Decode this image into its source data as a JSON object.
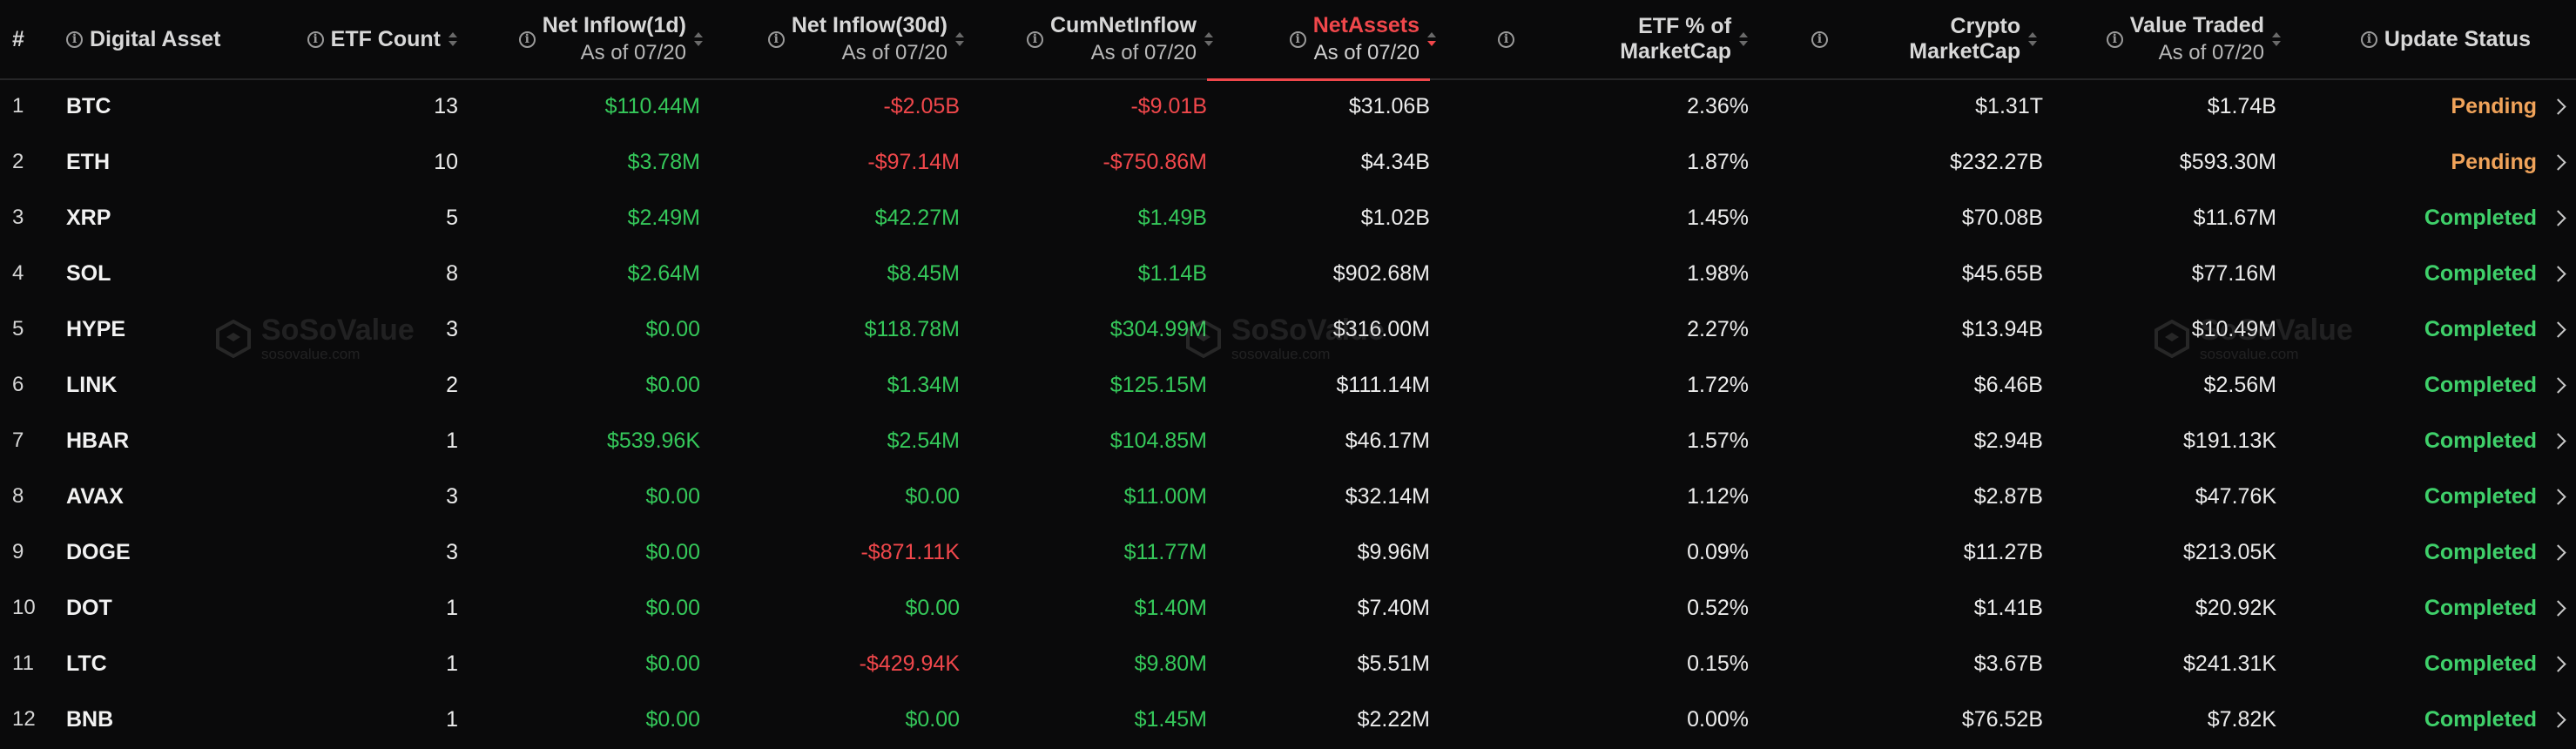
{
  "columns": {
    "index": "#",
    "asset": "Digital Asset",
    "etf_count": "ETF Count",
    "net_inflow_1d": {
      "label": "Net Inflow(1d)",
      "sub": "As of 07/20"
    },
    "net_inflow_30d": {
      "label": "Net Inflow(30d)",
      "sub": "As of 07/20"
    },
    "cum_net_inflow": {
      "label": "CumNetInflow",
      "sub": "As of 07/20"
    },
    "net_assets": {
      "label": "NetAssets",
      "sub": "As of 07/20"
    },
    "etf_pct_marketcap": "ETF % of MarketCap",
    "crypto_marketcap": "Crypto MarketCap",
    "value_traded": {
      "label": "Value Traded",
      "sub": "As of 07/20"
    },
    "update_status": "Update Status"
  },
  "colors": {
    "positive": "#35c85a",
    "negative": "#f0474b",
    "pending": "#f0a35a",
    "completed": "#3fd06a",
    "active_sort": "#f0474b"
  },
  "watermark": {
    "brand": "SoSoValue",
    "domain": "sosovalue.com"
  },
  "rows": [
    {
      "index": "1",
      "asset": "BTC",
      "etf_count": "13",
      "inflow_1d": "$110.44M",
      "inflow_1d_sign": "pos",
      "inflow_30d": "-$2.05B",
      "inflow_30d_sign": "neg",
      "cum": "-$9.01B",
      "cum_sign": "neg",
      "net_assets": "$31.06B",
      "etf_pct": "2.36%",
      "marketcap": "$1.31T",
      "traded": "$1.74B",
      "status": "Pending"
    },
    {
      "index": "2",
      "asset": "ETH",
      "etf_count": "10",
      "inflow_1d": "$3.78M",
      "inflow_1d_sign": "pos",
      "inflow_30d": "-$97.14M",
      "inflow_30d_sign": "neg",
      "cum": "-$750.86M",
      "cum_sign": "neg",
      "net_assets": "$4.34B",
      "etf_pct": "1.87%",
      "marketcap": "$232.27B",
      "traded": "$593.30M",
      "status": "Pending"
    },
    {
      "index": "3",
      "asset": "XRP",
      "etf_count": "5",
      "inflow_1d": "$2.49M",
      "inflow_1d_sign": "pos",
      "inflow_30d": "$42.27M",
      "inflow_30d_sign": "pos",
      "cum": "$1.49B",
      "cum_sign": "pos",
      "net_assets": "$1.02B",
      "etf_pct": "1.45%",
      "marketcap": "$70.08B",
      "traded": "$11.67M",
      "status": "Completed"
    },
    {
      "index": "4",
      "asset": "SOL",
      "etf_count": "8",
      "inflow_1d": "$2.64M",
      "inflow_1d_sign": "pos",
      "inflow_30d": "$8.45M",
      "inflow_30d_sign": "pos",
      "cum": "$1.14B",
      "cum_sign": "pos",
      "net_assets": "$902.68M",
      "etf_pct": "1.98%",
      "marketcap": "$45.65B",
      "traded": "$77.16M",
      "status": "Completed"
    },
    {
      "index": "5",
      "asset": "HYPE",
      "etf_count": "3",
      "inflow_1d": "$0.00",
      "inflow_1d_sign": "pos",
      "inflow_30d": "$118.78M",
      "inflow_30d_sign": "pos",
      "cum": "$304.99M",
      "cum_sign": "pos",
      "net_assets": "$316.00M",
      "etf_pct": "2.27%",
      "marketcap": "$13.94B",
      "traded": "$10.49M",
      "status": "Completed"
    },
    {
      "index": "6",
      "asset": "LINK",
      "etf_count": "2",
      "inflow_1d": "$0.00",
      "inflow_1d_sign": "pos",
      "inflow_30d": "$1.34M",
      "inflow_30d_sign": "pos",
      "cum": "$125.15M",
      "cum_sign": "pos",
      "net_assets": "$111.14M",
      "etf_pct": "1.72%",
      "marketcap": "$6.46B",
      "traded": "$2.56M",
      "status": "Completed"
    },
    {
      "index": "7",
      "asset": "HBAR",
      "etf_count": "1",
      "inflow_1d": "$539.96K",
      "inflow_1d_sign": "pos",
      "inflow_30d": "$2.54M",
      "inflow_30d_sign": "pos",
      "cum": "$104.85M",
      "cum_sign": "pos",
      "net_assets": "$46.17M",
      "etf_pct": "1.57%",
      "marketcap": "$2.94B",
      "traded": "$191.13K",
      "status": "Completed"
    },
    {
      "index": "8",
      "asset": "AVAX",
      "etf_count": "3",
      "inflow_1d": "$0.00",
      "inflow_1d_sign": "pos",
      "inflow_30d": "$0.00",
      "inflow_30d_sign": "pos",
      "cum": "$11.00M",
      "cum_sign": "pos",
      "net_assets": "$32.14M",
      "etf_pct": "1.12%",
      "marketcap": "$2.87B",
      "traded": "$47.76K",
      "status": "Completed"
    },
    {
      "index": "9",
      "asset": "DOGE",
      "etf_count": "3",
      "inflow_1d": "$0.00",
      "inflow_1d_sign": "pos",
      "inflow_30d": "-$871.11K",
      "inflow_30d_sign": "neg",
      "cum": "$11.77M",
      "cum_sign": "pos",
      "net_assets": "$9.96M",
      "etf_pct": "0.09%",
      "marketcap": "$11.27B",
      "traded": "$213.05K",
      "status": "Completed"
    },
    {
      "index": "10",
      "asset": "DOT",
      "etf_count": "1",
      "inflow_1d": "$0.00",
      "inflow_1d_sign": "pos",
      "inflow_30d": "$0.00",
      "inflow_30d_sign": "pos",
      "cum": "$1.40M",
      "cum_sign": "pos",
      "net_assets": "$7.40M",
      "etf_pct": "0.52%",
      "marketcap": "$1.41B",
      "traded": "$20.92K",
      "status": "Completed"
    },
    {
      "index": "11",
      "asset": "LTC",
      "etf_count": "1",
      "inflow_1d": "$0.00",
      "inflow_1d_sign": "pos",
      "inflow_30d": "-$429.94K",
      "inflow_30d_sign": "neg",
      "cum": "$9.80M",
      "cum_sign": "pos",
      "net_assets": "$5.51M",
      "etf_pct": "0.15%",
      "marketcap": "$3.67B",
      "traded": "$241.31K",
      "status": "Completed"
    },
    {
      "index": "12",
      "asset": "BNB",
      "etf_count": "1",
      "inflow_1d": "$0.00",
      "inflow_1d_sign": "pos",
      "inflow_30d": "$0.00",
      "inflow_30d_sign": "pos",
      "cum": "$1.45M",
      "cum_sign": "pos",
      "net_assets": "$2.22M",
      "etf_pct": "0.00%",
      "marketcap": "$76.52B",
      "traded": "$7.82K",
      "status": "Completed"
    }
  ]
}
